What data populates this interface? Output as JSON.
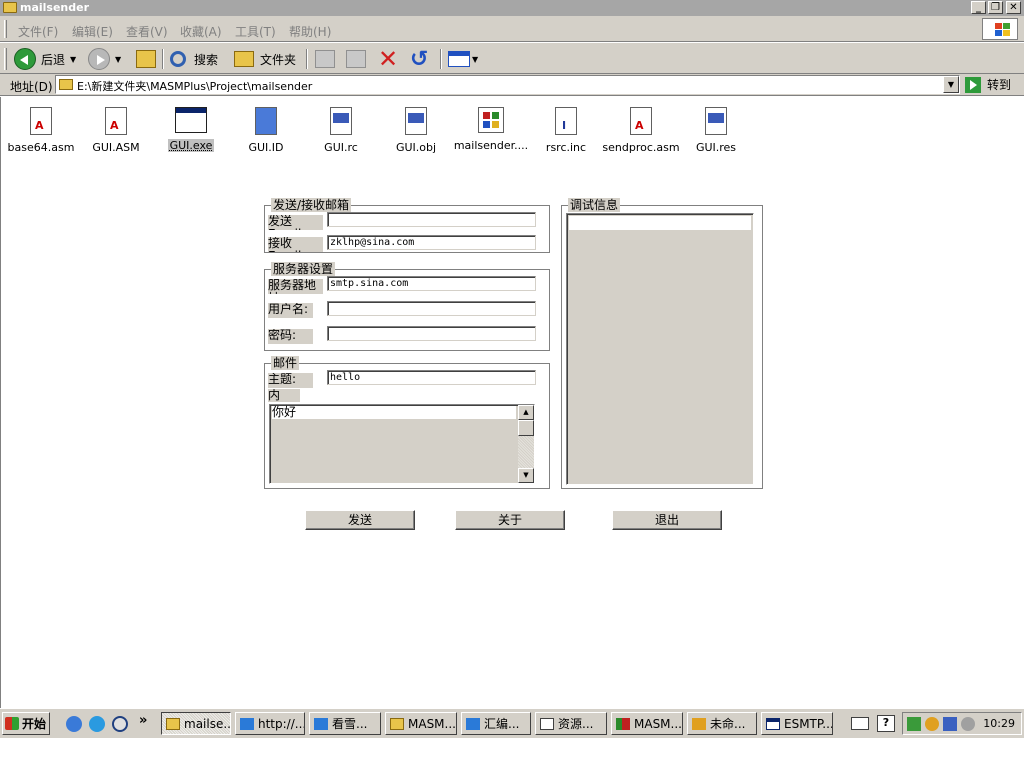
{
  "window": {
    "title": "mailsender"
  },
  "title_buttons": {
    "minimize": "_",
    "restore": "❐",
    "close": "✕"
  },
  "menu": [
    "文件(F)",
    "编辑(E)",
    "查看(V)",
    "收藏(A)",
    "工具(T)",
    "帮助(H)"
  ],
  "toolbar": {
    "back": "后退",
    "search": "搜索",
    "folders": "文件夹"
  },
  "address": {
    "label": "地址(D)",
    "path": "E:\\新建文件夹\\MASMPlus\\Project\\mailsender",
    "go": "转到"
  },
  "files": [
    {
      "name": "base64.asm",
      "type": "asm"
    },
    {
      "name": "GUI.ASM",
      "type": "asm"
    },
    {
      "name": "GUI.exe",
      "type": "exe"
    },
    {
      "name": "GUI.ID",
      "type": "id"
    },
    {
      "name": "GUI.rc",
      "type": "rc"
    },
    {
      "name": "GUI.obj",
      "type": "obj"
    },
    {
      "name": "mailsender....",
      "type": "mail"
    },
    {
      "name": "rsrc.inc",
      "type": "inc"
    },
    {
      "name": "sendproc.asm",
      "type": "asm"
    },
    {
      "name": "GUI.res",
      "type": "res"
    }
  ],
  "dialog": {
    "group_mailbox": "发送/接收邮箱",
    "send_email_label": "发送Email:",
    "send_email_value": "",
    "recv_email_label": "接收Email:",
    "recv_email_value": "zklhp@sina.com",
    "group_server": "服务器设置",
    "server_label": "服务器地址:",
    "server_value": "smtp.sina.com",
    "user_label": "用户名:",
    "user_value": "",
    "password_label": "密码:",
    "password_value": "",
    "group_mail": "邮件",
    "subject_label": "主题:",
    "subject_value": "hello",
    "content_label": "内",
    "content_value": "你好",
    "group_debug": "调试信息",
    "send_button": "发送",
    "about_button": "关于",
    "exit_button": "退出"
  },
  "taskbar": {
    "start": "开始",
    "more": "»",
    "tasks": [
      "mailse...",
      "http://...",
      "看雪...",
      "MASM...",
      "汇编...",
      "资源...",
      "MASM...",
      "未命...",
      "ESMTP..."
    ],
    "clock": "10:29"
  }
}
